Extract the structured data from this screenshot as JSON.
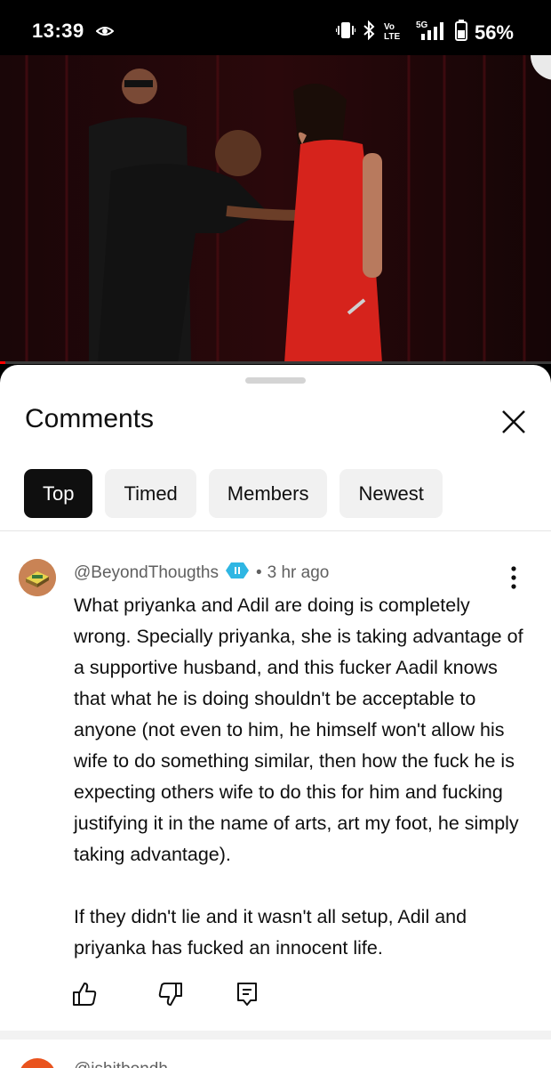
{
  "status_bar": {
    "time": "13:39",
    "battery_percent": "56%",
    "icons": [
      "vibrate-icon",
      "bluetooth-icon",
      "volte-icon",
      "signal-5g-icon",
      "battery-icon"
    ]
  },
  "video": {
    "progress_fraction": 0.01
  },
  "comments_panel": {
    "title": "Comments",
    "filters": [
      {
        "label": "Top",
        "active": true
      },
      {
        "label": "Timed",
        "active": false
      },
      {
        "label": "Members",
        "active": false
      },
      {
        "label": "Newest",
        "active": false
      }
    ],
    "comments": [
      {
        "author": "@BeyondThougths",
        "separator": "•",
        "time_ago": "3 hr ago",
        "paragraphs": [
          "What priyanka and Adil are doing is completely wrong. Specially priyanka, she is taking advantage of a supportive husband, and this fucker Aadil knows that what he is doing shouldn't be acceptable to anyone (not even to him, he himself won't allow his wife to do something similar, then how the fuck he is expecting others wife to do this for him and fucking justifying it in the name of arts, art my foot, he simply taking advantage).",
          "If they didn't lie and it wasn't all setup, Adil and priyanka has fucked an innocent life."
        ]
      }
    ],
    "next_comment_partial": "@jshitbondh..."
  },
  "colors": {
    "accent": "#ff0000",
    "active_chip_bg": "#0f0f0f",
    "chip_bg": "#f1f1f1",
    "member_badge": "#2fb6e3"
  }
}
